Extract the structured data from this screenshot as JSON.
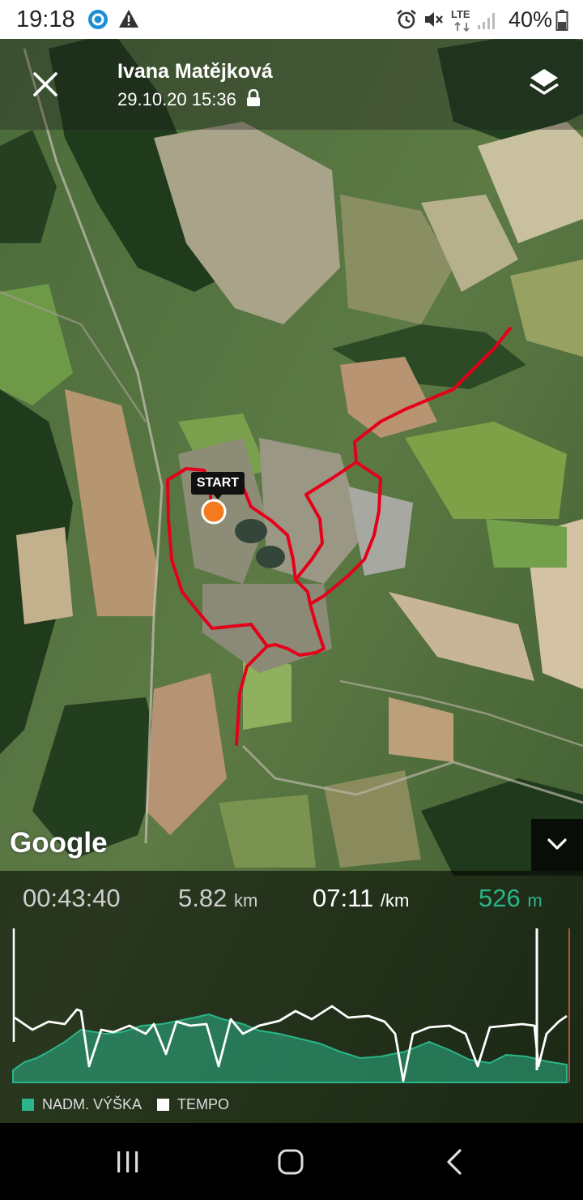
{
  "status_bar": {
    "time": "19:18",
    "network": "LTE",
    "battery": "40%"
  },
  "header": {
    "title": "Ivana Matějková",
    "subtitle": "29.10.20 15:36"
  },
  "map": {
    "start_label": "START",
    "attribution": "Google"
  },
  "stats": {
    "duration": "00:43:40",
    "distance_value": "5.82",
    "distance_unit": "km",
    "pace_value": "07:11",
    "pace_unit": "/km",
    "elevation_value": "526",
    "elevation_unit": "m"
  },
  "legend": {
    "elevation": "NADM. VÝŠKA",
    "tempo": "TEMPO"
  },
  "colors": {
    "route": "#e5001a",
    "start_marker": "#f47a20",
    "elevation": "#2bb58a",
    "tempo": "#ffffff",
    "cursor": "#e0604d"
  },
  "icons": {
    "close": "close-icon",
    "layers": "layers-icon",
    "lock": "lock-icon",
    "collapse": "chevron-down-icon"
  }
}
